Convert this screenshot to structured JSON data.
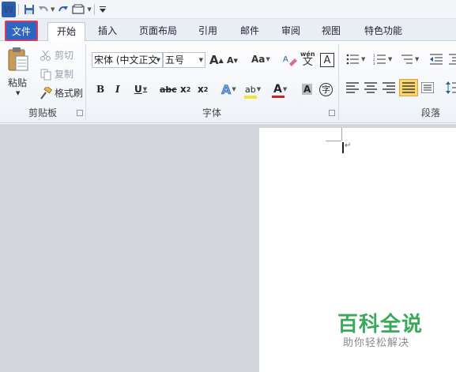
{
  "app": {
    "logo_letter": "W"
  },
  "quick_access": {
    "save": "save-icon",
    "undo": "undo-icon",
    "redo": "redo-icon",
    "customize": "customize-icon"
  },
  "tabs": [
    {
      "label": "文件"
    },
    {
      "label": "开始"
    },
    {
      "label": "插入"
    },
    {
      "label": "页面布局"
    },
    {
      "label": "引用"
    },
    {
      "label": "邮件"
    },
    {
      "label": "审阅"
    },
    {
      "label": "视图"
    },
    {
      "label": "特色功能"
    }
  ],
  "clipboard": {
    "paste": "粘贴",
    "cut": "剪切",
    "copy": "复制",
    "format_painter": "格式刷",
    "group_label": "剪贴板"
  },
  "font": {
    "font_name": "宋体 (中文正文",
    "font_size": "五号",
    "grow": "A",
    "shrink": "A",
    "change_case": "Aa",
    "phonetic": "wén",
    "phonetic_char": "文",
    "char_border": "A",
    "bold": "B",
    "italic": "I",
    "underline": "U",
    "strikethrough": "abc",
    "subscript": "x",
    "superscript": "x",
    "highlight": "ab",
    "font_color": "A",
    "char_shading": "A",
    "enclosed": "字",
    "group_label": "字体"
  },
  "paragraph": {
    "group_label": "段落"
  },
  "watermark": {
    "title": "百科全说",
    "subtitle": "助你轻松解决"
  },
  "colors": {
    "file_tab": "#2c66c2",
    "file_tab_border": "#e0375e",
    "highlight": "#f4e431",
    "font_color": "#d62020"
  }
}
